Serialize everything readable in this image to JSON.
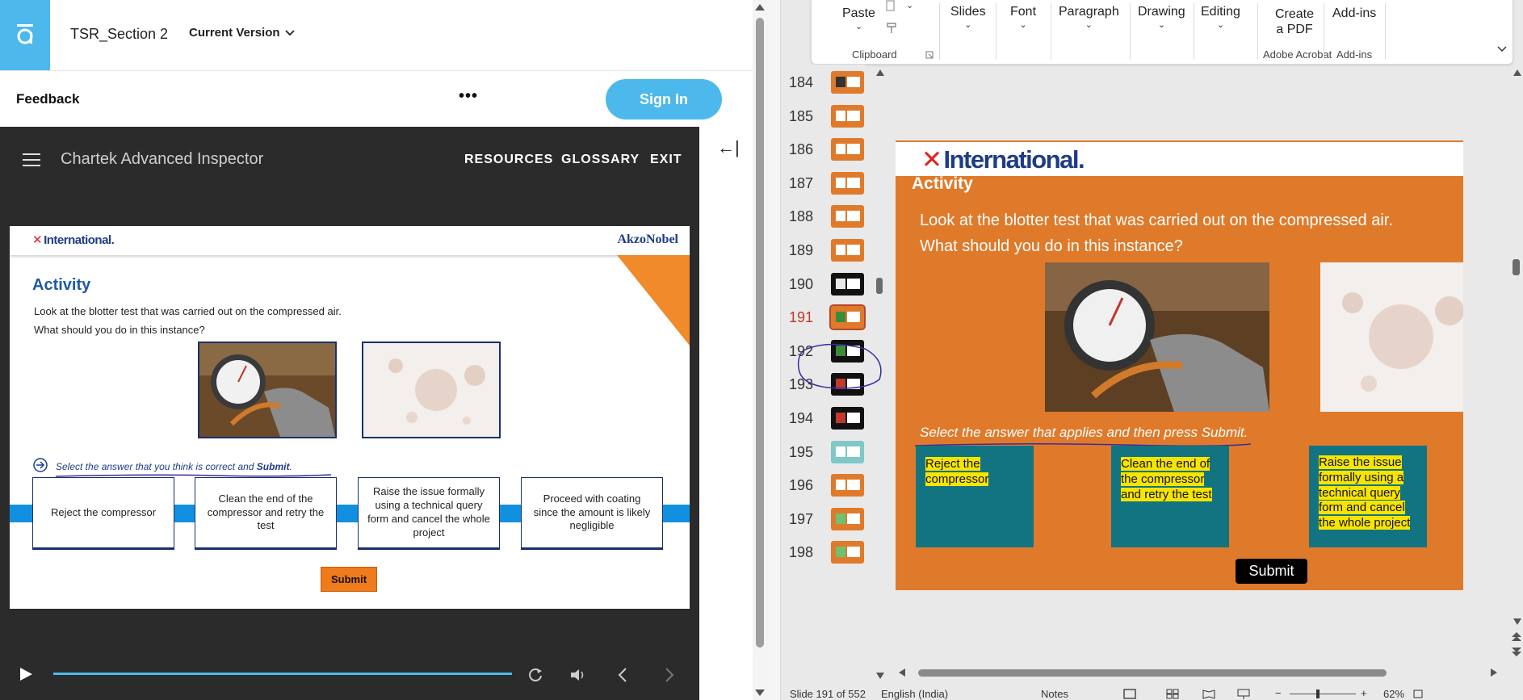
{
  "left_app": {
    "doc_title": "TSR_Section 2",
    "version_label": "Current Version",
    "feedback_label": "Feedback",
    "more_label": "•••",
    "sign_in_label": "Sign In",
    "collapse_label": "←|"
  },
  "player": {
    "course_title": "Chartek Advanced Inspector",
    "nav": {
      "resources": "RESOURCES",
      "glossary": "GLOSSARY",
      "exit": "EXIT"
    },
    "progress": 0.0
  },
  "slide": {
    "brand_left": "International.",
    "brand_right": "AkzoNobel",
    "title": "Activity",
    "question_1": "Look at the blotter test that was carried out on the compressed air.",
    "question_2": "What should you do in this instance?",
    "instruction_pre": "Select the answer that you think is correct and ",
    "instruction_bold": "Submit",
    "instruction_post": ".",
    "answers": [
      "Reject the compressor",
      "Clean the end of the compressor and retry the test",
      "Raise the issue formally using a technical query form and cancel the whole project",
      "Proceed with coating since the amount is likely negligible"
    ],
    "submit_label": "Submit"
  },
  "ppt": {
    "ribbon": {
      "paste": "Paste",
      "clipboard": "Clipboard",
      "slides": "Slides",
      "font": "Font",
      "paragraph": "Paragraph",
      "drawing": "Drawing",
      "editing": "Editing",
      "create_pdf_1": "Create",
      "create_pdf_2": "a PDF",
      "adobe_acrobat": "Adobe Acrobat",
      "add_ins": "Add-ins",
      "add_ins_group": "Add-ins"
    },
    "thumbnails": [
      "184",
      "185",
      "186",
      "187",
      "188",
      "189",
      "190",
      "191",
      "192",
      "193",
      "194",
      "195",
      "196",
      "197",
      "198"
    ],
    "active_slide": "191",
    "slide": {
      "brand": "International.",
      "title": "Activity",
      "question_1": "Look at the blotter test that was carried out on the compressed air.",
      "question_2": "What should you do in this instance?",
      "instruction": "Select the answer that applies and then press Submit.",
      "answers": [
        "Reject the compressor",
        "Clean the end of the compressor and retry the test",
        "Raise the issue formally using a technical query form and cancel the whole project"
      ],
      "submit_label": "Submit"
    },
    "status": {
      "slide_counter": "Slide 191 of 552",
      "language": "English (India)",
      "notes": "Notes",
      "zoom": "62%"
    }
  },
  "colors": {
    "accent_blue": "#4db8ec",
    "slide_orange": "#e07a2b",
    "teal": "#127480",
    "highlight_yellow": "#f7e400",
    "brand_navy": "#1f3c88",
    "brand_red": "#e2231a"
  }
}
